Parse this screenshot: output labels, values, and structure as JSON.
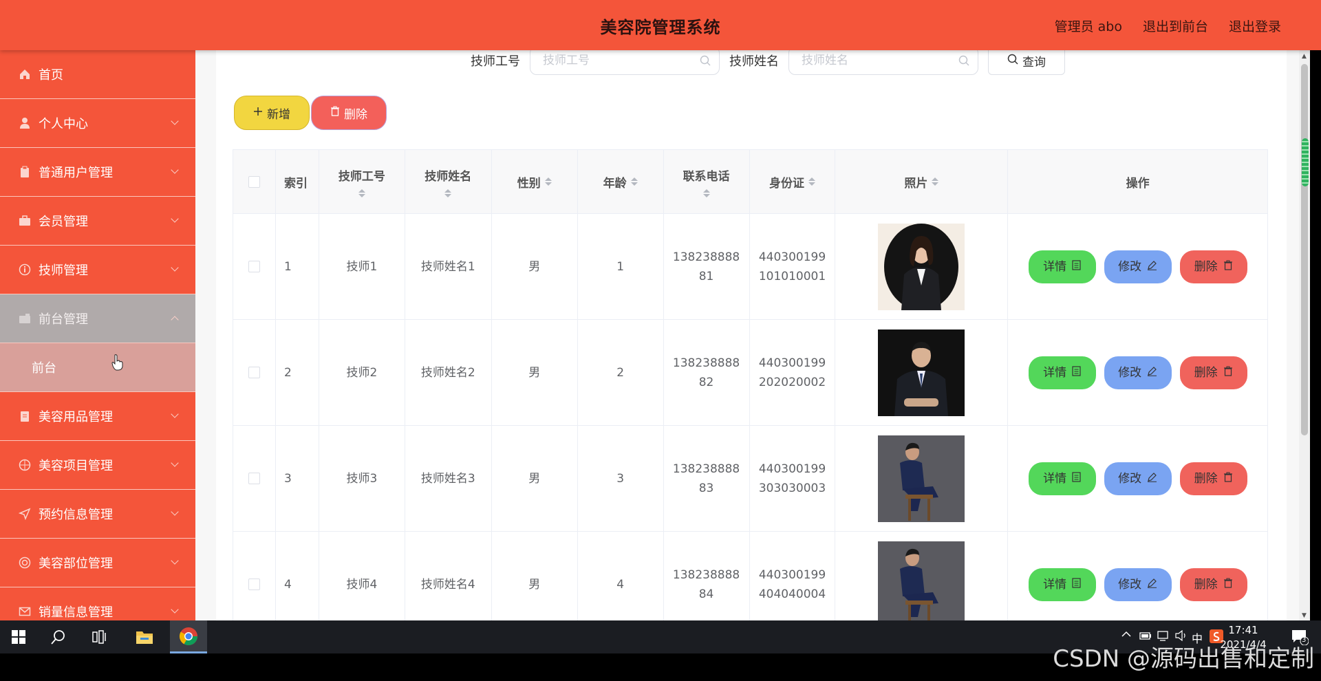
{
  "header": {
    "title": "美容院管理系统",
    "links": [
      "管理员 abo",
      "退出到前台",
      "退出登录"
    ]
  },
  "sidebar": {
    "items": [
      {
        "label": "首页",
        "icon": "home-icon"
      },
      {
        "label": "个人中心",
        "icon": "user-icon"
      },
      {
        "label": "普通用户管理",
        "icon": "clipboard-icon"
      },
      {
        "label": "会员管理",
        "icon": "briefcase-icon"
      },
      {
        "label": "技师管理",
        "icon": "info-circle-icon"
      },
      {
        "label": "前台管理",
        "icon": "wallet-icon"
      },
      {
        "label": "美容用品管理",
        "icon": "document-icon"
      },
      {
        "label": "美容项目管理",
        "icon": "target-icon"
      },
      {
        "label": "预约信息管理",
        "icon": "send-icon"
      },
      {
        "label": "美容部位管理",
        "icon": "circle-icon"
      },
      {
        "label": "销量信息管理",
        "icon": "mail-icon"
      }
    ],
    "sub_item": "前台"
  },
  "search": {
    "no_label": "技师工号",
    "no_placeholder": "技师工号",
    "name_label": "技师姓名",
    "name_placeholder": "技师姓名",
    "query_label": "查询"
  },
  "actions": {
    "add_label": "新增",
    "delete_label": "删除"
  },
  "table": {
    "headers": {
      "index": "索引",
      "no": "技师工号",
      "name": "技师姓名",
      "sex": "性别",
      "age": "年龄",
      "tel": "联系电话",
      "id": "身份证",
      "photo": "照片",
      "op": "操作"
    },
    "rows": [
      {
        "index": "1",
        "no": "技师1",
        "name": "技师姓名1",
        "sex": "男",
        "age": "1",
        "tel1": "138238888",
        "tel2": "81",
        "id1": "440300199",
        "id2": "101010001"
      },
      {
        "index": "2",
        "no": "技师2",
        "name": "技师姓名2",
        "sex": "男",
        "age": "2",
        "tel1": "138238888",
        "tel2": "82",
        "id1": "440300199",
        "id2": "202020002"
      },
      {
        "index": "3",
        "no": "技师3",
        "name": "技师姓名3",
        "sex": "男",
        "age": "3",
        "tel1": "138238888",
        "tel2": "83",
        "id1": "440300199",
        "id2": "303030003"
      },
      {
        "index": "4",
        "no": "技师4",
        "name": "技师姓名4",
        "sex": "男",
        "age": "4",
        "tel1": "138238888",
        "tel2": "84",
        "id1": "440300199",
        "id2": "404040004"
      }
    ],
    "op_labels": {
      "detail": "详情",
      "edit": "修改",
      "delete": "删除"
    }
  },
  "taskbar": {
    "time": "17:41",
    "date": "2021/4/4",
    "ime": "中",
    "notify_count": "3"
  },
  "watermark": "CSDN @源码出售和定制",
  "colors": {
    "brand": "#f4553a",
    "detail": "#53d75a",
    "edit": "#7aa4f2",
    "delete": "#f0635c",
    "add": "#f2d640"
  }
}
